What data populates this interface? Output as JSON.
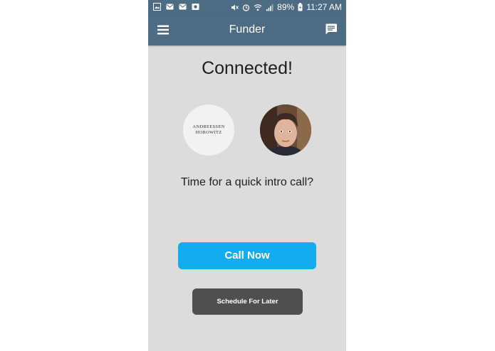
{
  "status_bar": {
    "battery": "89%",
    "time": "11:27 AM",
    "left_icons": [
      "gallery-icon",
      "mail-icon",
      "mail-icon",
      "photos-icon"
    ],
    "right_icons": [
      "mute-icon",
      "alarm-icon",
      "wifi-icon",
      "signal-icon",
      "battery-icon"
    ]
  },
  "app_bar": {
    "title": "Funder",
    "menu_icon": "hamburger-menu-icon",
    "chat_icon": "chat-icon"
  },
  "main": {
    "headline": "Connected!",
    "logo_avatar": {
      "line1": "ANDREESSEN",
      "line2": "HOROWITZ"
    },
    "user_avatar": "user-avatar",
    "prompt": "Time for a quick intro call?",
    "call_button": "Call Now",
    "schedule_button": "Schedule For Later"
  },
  "colors": {
    "app_bar": "#4d6b82",
    "background": "#dcdcdc",
    "primary_button": "#12acef",
    "secondary_button": "#4f4f4f"
  }
}
